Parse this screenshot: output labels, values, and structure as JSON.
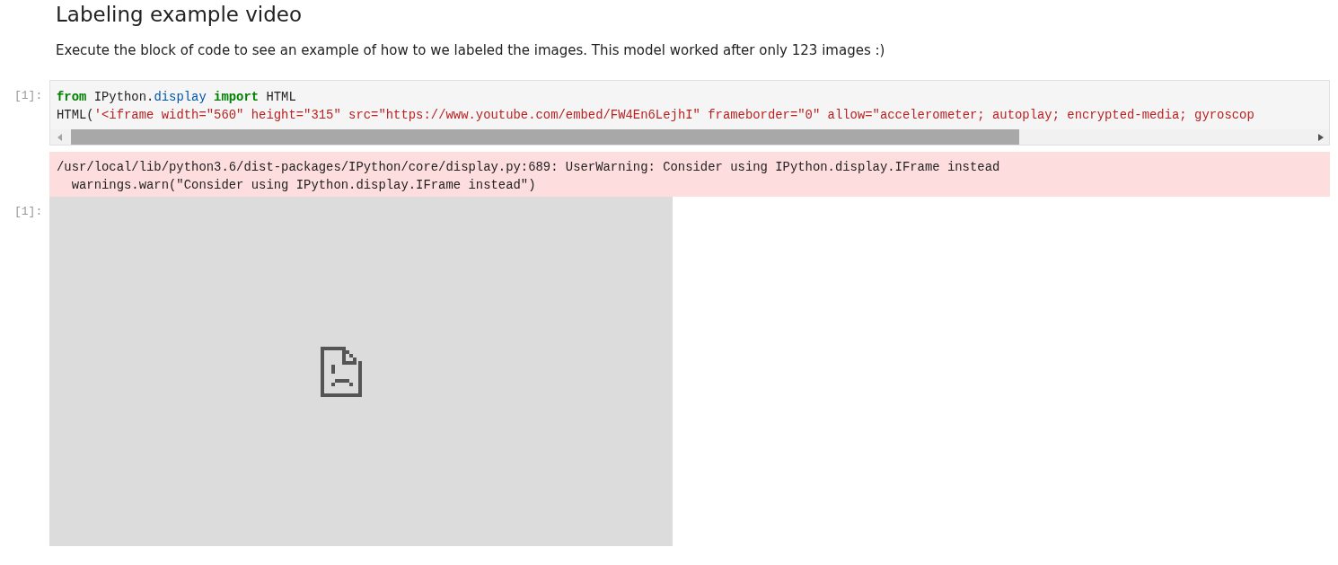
{
  "heading": "Labeling example video",
  "paragraph": "Execute the block of code to see an example of how to we labeled the images. This model worked after only 123 images :)",
  "input_cell": {
    "prompt": "[1]:",
    "lines": [
      [
        {
          "kind": "keyword",
          "text": "from"
        },
        {
          "kind": "plain",
          "text": " IPython."
        },
        {
          "kind": "module",
          "text": "display "
        },
        {
          "kind": "keyword",
          "text": "import"
        },
        {
          "kind": "plain",
          "text": " HTML"
        }
      ],
      [
        {
          "kind": "plain",
          "text": "HTML("
        },
        {
          "kind": "string",
          "text": "'<iframe width=\"560\" height=\"315\" src=\"https://www.youtube.com/embed/FW4En6LejhI\" frameborder=\"0\" allow=\"accelerometer; autoplay; encrypted-media; gyroscop"
        }
      ]
    ]
  },
  "warning": {
    "lines": [
      "/usr/local/lib/python3.6/dist-packages/IPython/core/display.py:689: UserWarning: Consider using IPython.display.IFrame instead",
      "  warnings.warn(\"Consider using IPython.display.IFrame instead\")"
    ]
  },
  "output_cell": {
    "prompt": "[1]:",
    "kind": "broken-frame"
  }
}
